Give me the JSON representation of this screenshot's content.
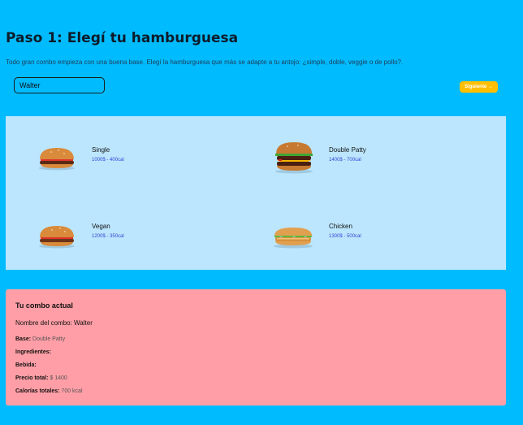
{
  "header": {
    "title": "Paso 1: Elegí tu hamburguesa",
    "subtitle": "Todo gran combo empieza con una buena base. Elegí la hamburguesa que más se adapte a tu antojo: ¿simple, doble, veggie o de pollo?."
  },
  "combo_name_input": {
    "value": "Walter"
  },
  "next_button": {
    "label": "Siguiente →"
  },
  "burgers": [
    {
      "name": "Single",
      "meta": "1000$ - 400cal"
    },
    {
      "name": "Double Patty",
      "meta": "1400$ - 700cal"
    },
    {
      "name": "Vegan",
      "meta": "1200$ - 350cal"
    },
    {
      "name": "Chicken",
      "meta": "1300$ - 500cal"
    }
  ],
  "summary": {
    "title": "Tu combo actual",
    "name_label": "Nombre del combo:",
    "name_value": "Walter",
    "base_label": "Base:",
    "base_value": "Double Patty",
    "ingredients_label": "Ingredientes:",
    "ingredients_value": "",
    "drink_label": "Bebida:",
    "drink_value": "",
    "price_label": "Precio total:",
    "price_value": "$ 1400",
    "calories_label": "Calorías totales:",
    "calories_value": "700 kcal"
  }
}
